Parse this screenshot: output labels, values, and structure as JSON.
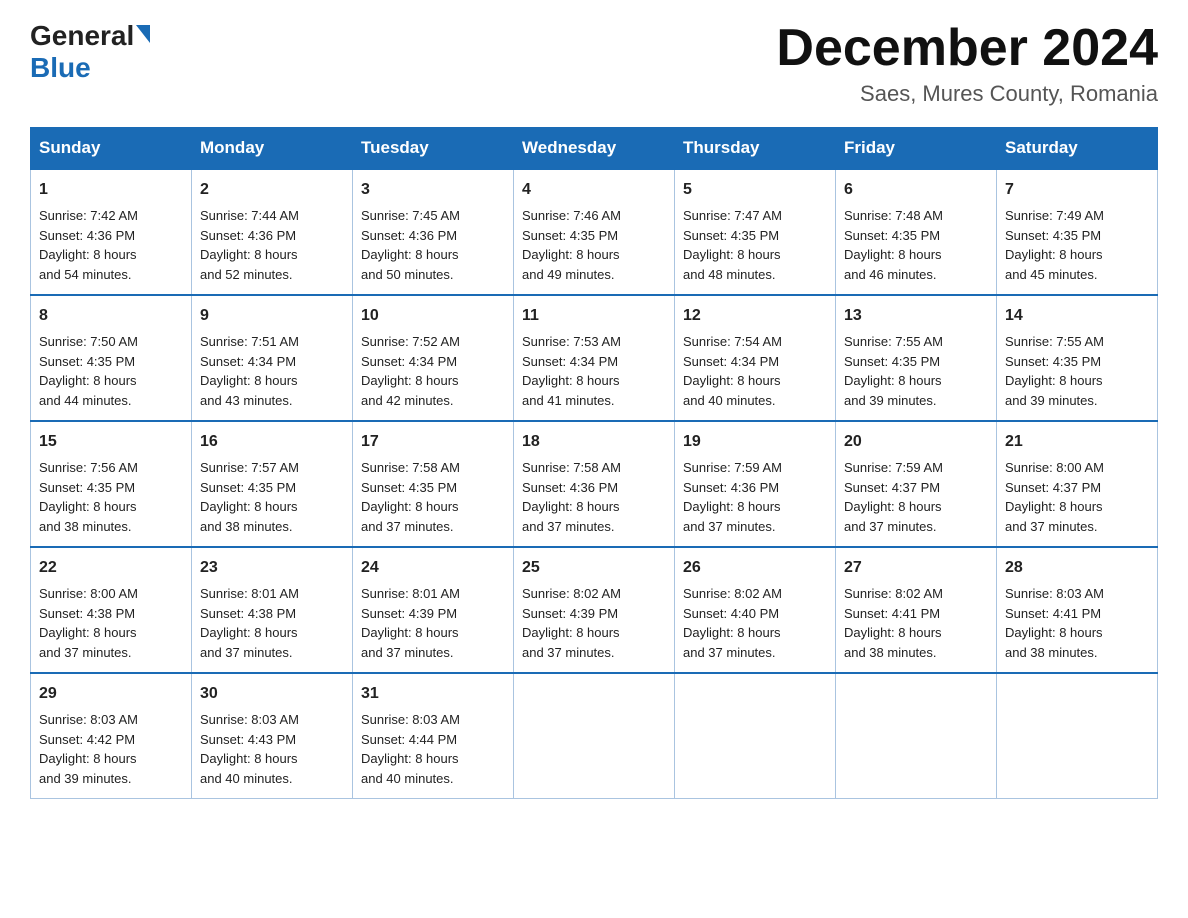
{
  "header": {
    "logo_general": "General",
    "logo_blue": "Blue",
    "month_year": "December 2024",
    "location": "Saes, Mures County, Romania"
  },
  "days_of_week": [
    "Sunday",
    "Monday",
    "Tuesday",
    "Wednesday",
    "Thursday",
    "Friday",
    "Saturday"
  ],
  "weeks": [
    [
      {
        "num": "1",
        "sunrise": "7:42 AM",
        "sunset": "4:36 PM",
        "daylight": "8 hours and 54 minutes."
      },
      {
        "num": "2",
        "sunrise": "7:44 AM",
        "sunset": "4:36 PM",
        "daylight": "8 hours and 52 minutes."
      },
      {
        "num": "3",
        "sunrise": "7:45 AM",
        "sunset": "4:36 PM",
        "daylight": "8 hours and 50 minutes."
      },
      {
        "num": "4",
        "sunrise": "7:46 AM",
        "sunset": "4:35 PM",
        "daylight": "8 hours and 49 minutes."
      },
      {
        "num": "5",
        "sunrise": "7:47 AM",
        "sunset": "4:35 PM",
        "daylight": "8 hours and 48 minutes."
      },
      {
        "num": "6",
        "sunrise": "7:48 AM",
        "sunset": "4:35 PM",
        "daylight": "8 hours and 46 minutes."
      },
      {
        "num": "7",
        "sunrise": "7:49 AM",
        "sunset": "4:35 PM",
        "daylight": "8 hours and 45 minutes."
      }
    ],
    [
      {
        "num": "8",
        "sunrise": "7:50 AM",
        "sunset": "4:35 PM",
        "daylight": "8 hours and 44 minutes."
      },
      {
        "num": "9",
        "sunrise": "7:51 AM",
        "sunset": "4:34 PM",
        "daylight": "8 hours and 43 minutes."
      },
      {
        "num": "10",
        "sunrise": "7:52 AM",
        "sunset": "4:34 PM",
        "daylight": "8 hours and 42 minutes."
      },
      {
        "num": "11",
        "sunrise": "7:53 AM",
        "sunset": "4:34 PM",
        "daylight": "8 hours and 41 minutes."
      },
      {
        "num": "12",
        "sunrise": "7:54 AM",
        "sunset": "4:34 PM",
        "daylight": "8 hours and 40 minutes."
      },
      {
        "num": "13",
        "sunrise": "7:55 AM",
        "sunset": "4:35 PM",
        "daylight": "8 hours and 39 minutes."
      },
      {
        "num": "14",
        "sunrise": "7:55 AM",
        "sunset": "4:35 PM",
        "daylight": "8 hours and 39 minutes."
      }
    ],
    [
      {
        "num": "15",
        "sunrise": "7:56 AM",
        "sunset": "4:35 PM",
        "daylight": "8 hours and 38 minutes."
      },
      {
        "num": "16",
        "sunrise": "7:57 AM",
        "sunset": "4:35 PM",
        "daylight": "8 hours and 38 minutes."
      },
      {
        "num": "17",
        "sunrise": "7:58 AM",
        "sunset": "4:35 PM",
        "daylight": "8 hours and 37 minutes."
      },
      {
        "num": "18",
        "sunrise": "7:58 AM",
        "sunset": "4:36 PM",
        "daylight": "8 hours and 37 minutes."
      },
      {
        "num": "19",
        "sunrise": "7:59 AM",
        "sunset": "4:36 PM",
        "daylight": "8 hours and 37 minutes."
      },
      {
        "num": "20",
        "sunrise": "7:59 AM",
        "sunset": "4:37 PM",
        "daylight": "8 hours and 37 minutes."
      },
      {
        "num": "21",
        "sunrise": "8:00 AM",
        "sunset": "4:37 PM",
        "daylight": "8 hours and 37 minutes."
      }
    ],
    [
      {
        "num": "22",
        "sunrise": "8:00 AM",
        "sunset": "4:38 PM",
        "daylight": "8 hours and 37 minutes."
      },
      {
        "num": "23",
        "sunrise": "8:01 AM",
        "sunset": "4:38 PM",
        "daylight": "8 hours and 37 minutes."
      },
      {
        "num": "24",
        "sunrise": "8:01 AM",
        "sunset": "4:39 PM",
        "daylight": "8 hours and 37 minutes."
      },
      {
        "num": "25",
        "sunrise": "8:02 AM",
        "sunset": "4:39 PM",
        "daylight": "8 hours and 37 minutes."
      },
      {
        "num": "26",
        "sunrise": "8:02 AM",
        "sunset": "4:40 PM",
        "daylight": "8 hours and 37 minutes."
      },
      {
        "num": "27",
        "sunrise": "8:02 AM",
        "sunset": "4:41 PM",
        "daylight": "8 hours and 38 minutes."
      },
      {
        "num": "28",
        "sunrise": "8:03 AM",
        "sunset": "4:41 PM",
        "daylight": "8 hours and 38 minutes."
      }
    ],
    [
      {
        "num": "29",
        "sunrise": "8:03 AM",
        "sunset": "4:42 PM",
        "daylight": "8 hours and 39 minutes."
      },
      {
        "num": "30",
        "sunrise": "8:03 AM",
        "sunset": "4:43 PM",
        "daylight": "8 hours and 40 minutes."
      },
      {
        "num": "31",
        "sunrise": "8:03 AM",
        "sunset": "4:44 PM",
        "daylight": "8 hours and 40 minutes."
      },
      null,
      null,
      null,
      null
    ]
  ],
  "labels": {
    "sunrise": "Sunrise:",
    "sunset": "Sunset:",
    "daylight": "Daylight:"
  }
}
